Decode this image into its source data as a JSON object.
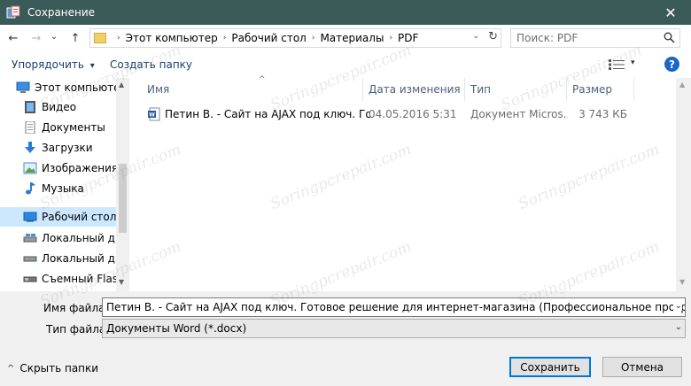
{
  "window": {
    "title": "Сохранение",
    "close_glyph": "✕"
  },
  "nav": {
    "back_glyph": "←",
    "forward_glyph": "→",
    "recent_glyph": "⌄",
    "up_glyph": "↑",
    "breadcrumbs": [
      "Этот компьютер",
      "Рабочий стол",
      "Материалы",
      "PDF"
    ],
    "crumb_sep": "›",
    "dropdown_glyph": "⌄",
    "refresh_glyph": "↻",
    "search_placeholder": "Поиск: PDF"
  },
  "toolbar": {
    "organize_label": "Упорядочить",
    "organize_caret": "▾",
    "new_folder_label": "Создать папку",
    "view_caret": "▾",
    "help_label": "?"
  },
  "sidebar": {
    "items": [
      {
        "label": "Этот компьютер",
        "icon": "computer-icon"
      },
      {
        "label": "Видео",
        "icon": "video-icon"
      },
      {
        "label": "Документы",
        "icon": "documents-icon"
      },
      {
        "label": "Загрузки",
        "icon": "downloads-icon"
      },
      {
        "label": "Изображения",
        "icon": "pictures-icon"
      },
      {
        "label": "Музыка",
        "icon": "music-icon"
      },
      {
        "label": "Рабочий стол",
        "icon": "desktop-icon"
      },
      {
        "label": "Локальный дис",
        "icon": "drive-icon"
      },
      {
        "label": "Локальный дис",
        "icon": "drive-icon"
      },
      {
        "label": "Съемный Flash-",
        "icon": "usb-drive-icon"
      }
    ],
    "selected_index": 6,
    "scroll_up": "▲",
    "scroll_down": "▼"
  },
  "file_list": {
    "columns": [
      "Имя",
      "Дата изменения",
      "Тип",
      "Размер"
    ],
    "sort_glyph": "^",
    "rows": [
      {
        "name": "Петин В. - Сайт на AJAX под ключ. Гот...",
        "modified": "04.05.2016 5:31",
        "type": "Документ Micros...",
        "size": "3 743 КБ"
      }
    ],
    "scroll_up": "▲",
    "scroll_down": "▼"
  },
  "form": {
    "filename_label": "Имя файла:",
    "filename_value": "Петин В. - Сайт на AJAX под ключ. Готовое решение для интернет-магазина (Профессиональное программирование) -",
    "filetype_label": "Тип файла:",
    "filetype_value": "Документы Word (*.docx)",
    "chevron": "⌄"
  },
  "footer": {
    "hide_folders_caret": "^",
    "hide_folders_label": "Скрыть папки",
    "save_label": "Сохранить",
    "cancel_label": "Отмена"
  },
  "watermark": "Soringpcrepair.com",
  "colors": {
    "titlebar": "#3a5a57",
    "accent": "#0078d7",
    "selected": "#cce8ff"
  }
}
